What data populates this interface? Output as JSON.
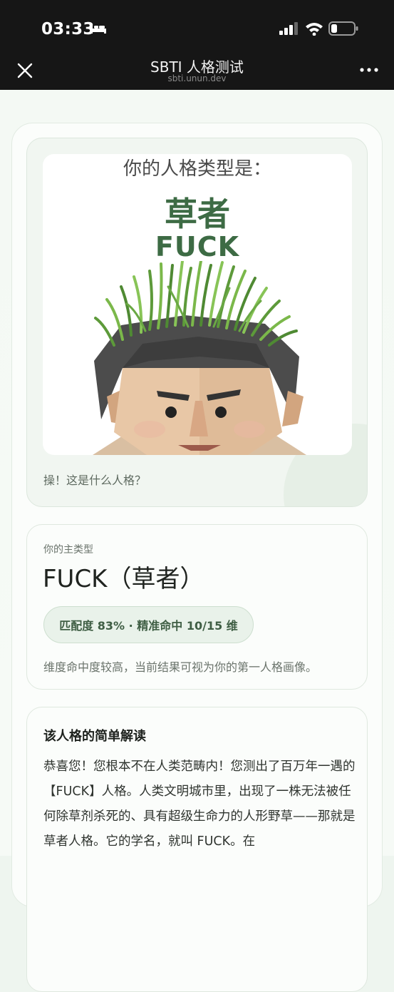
{
  "status_bar": {
    "time": "03:33"
  },
  "nav": {
    "title": "SBTI 人格测试",
    "subtitle": "sbti.unun.dev"
  },
  "hero": {
    "kicker": "你的人格类型是：",
    "name_cn": "草者",
    "name_en": "FUCK",
    "caption": "操！这是什么人格？"
  },
  "type_card": {
    "kicker": "你的主类型",
    "name": "FUCK（草者）",
    "match": "匹配度 83% · 精准命中 10/15 维",
    "note": "维度命中度较高，当前结果可视为你的第一人格画像。"
  },
  "description": {
    "title": "该人格的简单解读",
    "body": "恭喜您！您根本不在人类范畴内！您测出了百万年一遇的【FUCK】人格。人类文明城市里，出现了一株无法被任何除草剂杀死的、具有超级生命力的人形野草——那就是草者人格。它的学名，就叫 FUCK。在"
  },
  "colors": {
    "accent_green": "#3d6b44",
    "top_bar": "#161616",
    "page_bg": "#f4f9f4"
  },
  "icons": [
    "bed-icon",
    "signal-icon",
    "wifi-icon",
    "battery-icon",
    "close-icon",
    "more-icon"
  ]
}
